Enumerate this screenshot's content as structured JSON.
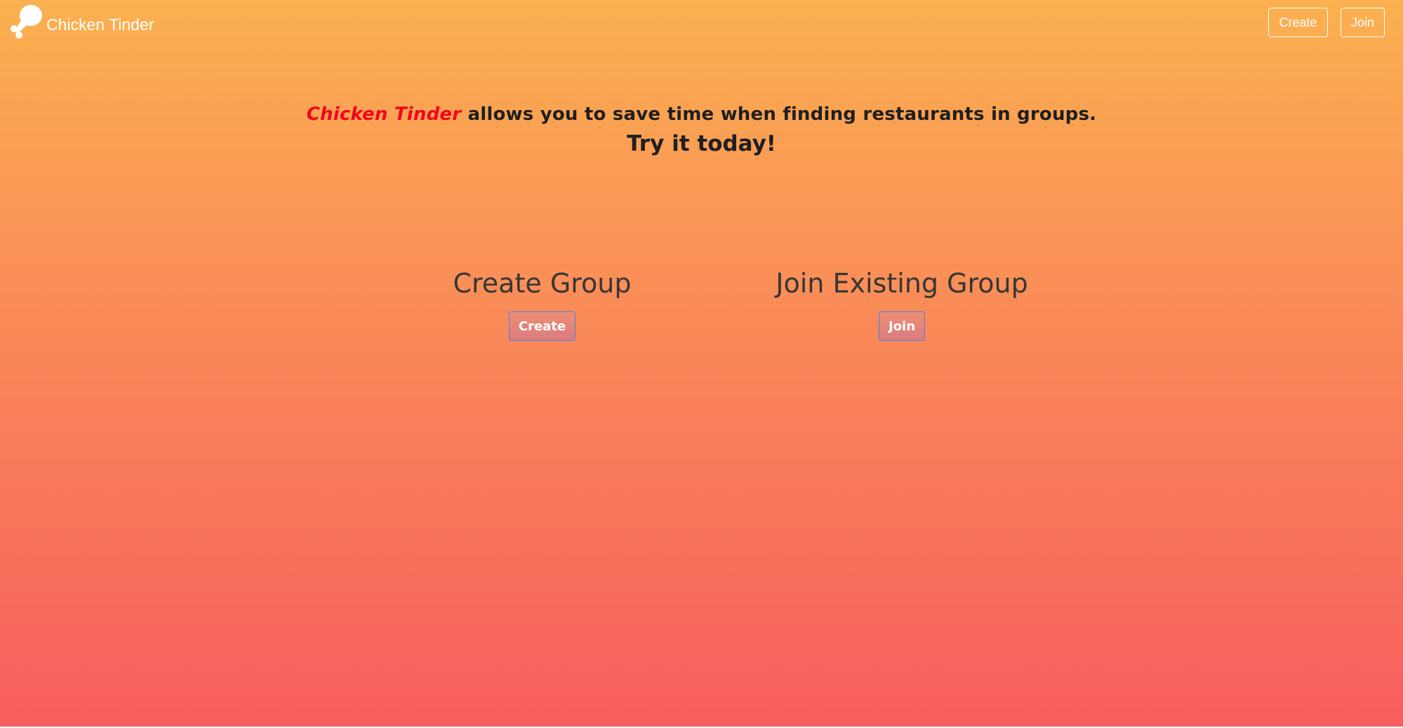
{
  "navbar": {
    "brand_name": "Chicken Tinder",
    "logo_icon": "chicken-drumstick-icon",
    "create_label": "Create",
    "join_label": "Join"
  },
  "hero": {
    "brand_highlight": "Chicken Tinder",
    "tagline_rest": " allows you to save time when finding restaurants in groups.",
    "call_to_action": "Try it today!"
  },
  "create_group": {
    "title": "Create Group",
    "button_label": "Create"
  },
  "join_group": {
    "title": "Join Existing Group",
    "button_label": "Join"
  },
  "colors": {
    "gradient_top": "#fbb150",
    "gradient_bottom": "#f75d5f",
    "brand_highlight": "#f2071d",
    "button_border": "#4f7fe8"
  }
}
